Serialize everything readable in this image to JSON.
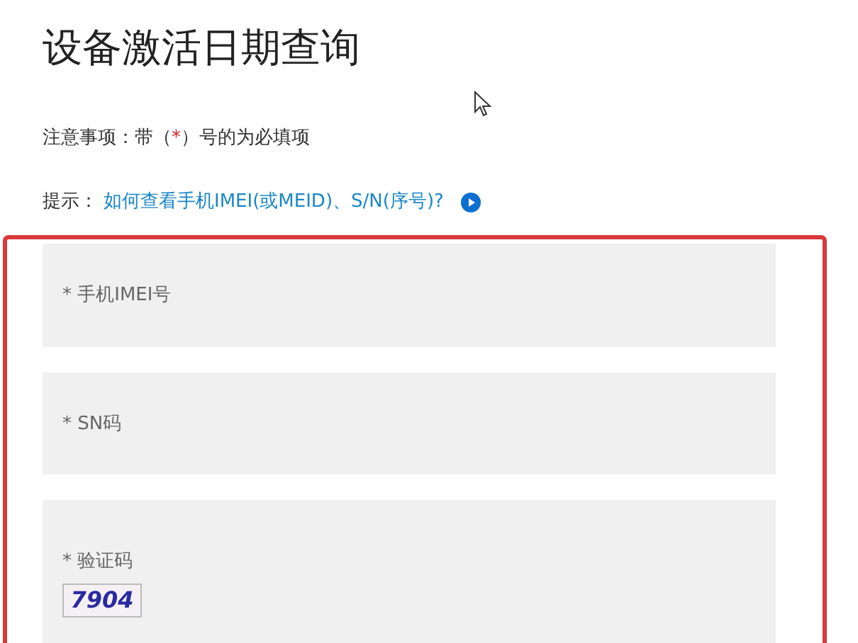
{
  "title": "设备激活日期查询",
  "notice": {
    "before": "注意事项：带（",
    "mark": "*",
    "after": "）号的为必填项"
  },
  "tip": {
    "label": "提示：",
    "link": "如何查看手机IMEI(或MEID)、S/N(序号)?"
  },
  "fields": [
    {
      "kind": "text",
      "placeholder": "* 手机IMEI号"
    },
    {
      "kind": "text",
      "placeholder": "* SN码"
    },
    {
      "kind": "captcha",
      "placeholder": "* 验证码",
      "captcha": "7904"
    }
  ]
}
